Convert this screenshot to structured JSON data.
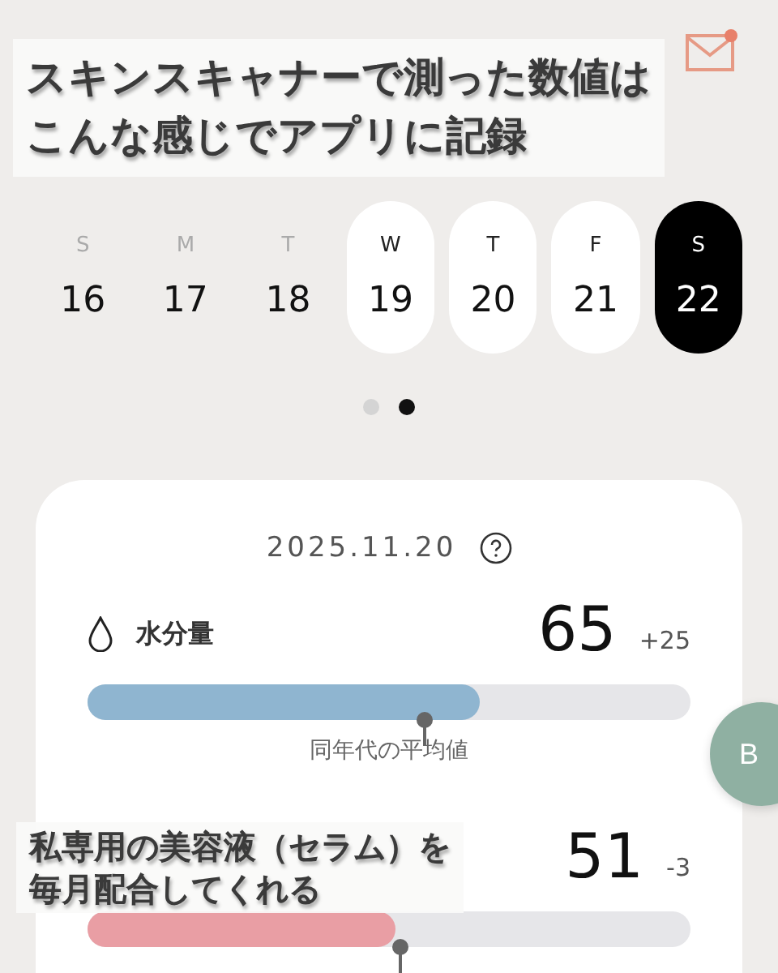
{
  "header": {
    "mail_unread": true
  },
  "captions": [
    {
      "lines": [
        "スキンスキャナーで測った数値は",
        "こんな感じでアプリに記録"
      ]
    },
    {
      "lines": [
        "私専用の美容液（セラム）を",
        "毎月配合してくれる"
      ]
    }
  ],
  "week": [
    {
      "weekday": "S",
      "day": "16",
      "recorded": false,
      "selected": false
    },
    {
      "weekday": "M",
      "day": "17",
      "recorded": false,
      "selected": false
    },
    {
      "weekday": "T",
      "day": "18",
      "recorded": false,
      "selected": false
    },
    {
      "weekday": "W",
      "day": "19",
      "recorded": true,
      "selected": false
    },
    {
      "weekday": "T",
      "day": "20",
      "recorded": true,
      "selected": false
    },
    {
      "weekday": "F",
      "day": "21",
      "recorded": true,
      "selected": false
    },
    {
      "weekday": "S",
      "day": "22",
      "recorded": true,
      "selected": true
    }
  ],
  "pager": [
    {
      "selected": false
    },
    {
      "selected": true
    }
  ],
  "card": {
    "date": "2025.11.20",
    "metrics": [
      {
        "label": "水分量",
        "value": "65",
        "delta": "+25",
        "level": 0.65,
        "color": "#8fb5d0",
        "average_label": "同年代の平均値"
      },
      {
        "value": "51",
        "delta": "-3",
        "level": 0.51,
        "color": "#e99ea4"
      }
    ]
  },
  "fab": {
    "label": "B"
  }
}
